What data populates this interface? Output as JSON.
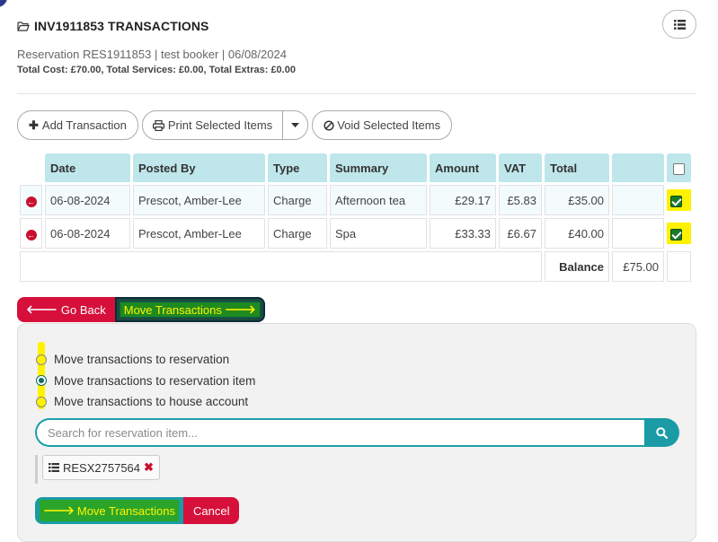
{
  "header": {
    "title": "INV1911853 TRANSACTIONS",
    "subtitle": "Reservation RES1911853 | test booker | 06/08/2024",
    "totals": "Total Cost: £70.00, Total Services: £0.00, Total Extras: £0.00"
  },
  "toolbar": {
    "add_label": "Add Transaction",
    "print_label": "Print Selected Items",
    "void_label": "Void Selected Items"
  },
  "table": {
    "columns": [
      "Date",
      "Posted By",
      "Type",
      "Summary",
      "Amount",
      "VAT",
      "Total",
      ""
    ],
    "rows": [
      {
        "date": "06-08-2024",
        "posted_by": "Prescot, Amber-Lee",
        "type": "Charge",
        "summary": "Afternoon tea",
        "amount": "£29.17",
        "vat": "£5.83",
        "total": "£35.00",
        "checked": true
      },
      {
        "date": "06-08-2024",
        "posted_by": "Prescot, Amber-Lee",
        "type": "Charge",
        "summary": "Spa",
        "amount": "£33.33",
        "vat": "£6.67",
        "total": "£40.00",
        "checked": true
      }
    ],
    "balance_label": "Balance",
    "balance_value": "£75.00"
  },
  "actions": {
    "go_back": "Go Back",
    "move_transactions": "Move Transactions"
  },
  "move_panel": {
    "options": [
      {
        "label": "Move transactions to reservation",
        "selected": false
      },
      {
        "label": "Move transactions to reservation item",
        "selected": true
      },
      {
        "label": "Move transactions to house account",
        "selected": false
      }
    ],
    "search_placeholder": "Search for reservation item...",
    "selected_tag": "RESX2757564",
    "move_button": "Move Transactions",
    "cancel_button": "Cancel"
  },
  "colors": {
    "header_cell": "#bfe6ea",
    "teal": "#1a9ba5",
    "red": "#d6103b",
    "highlight": "#fff200"
  }
}
